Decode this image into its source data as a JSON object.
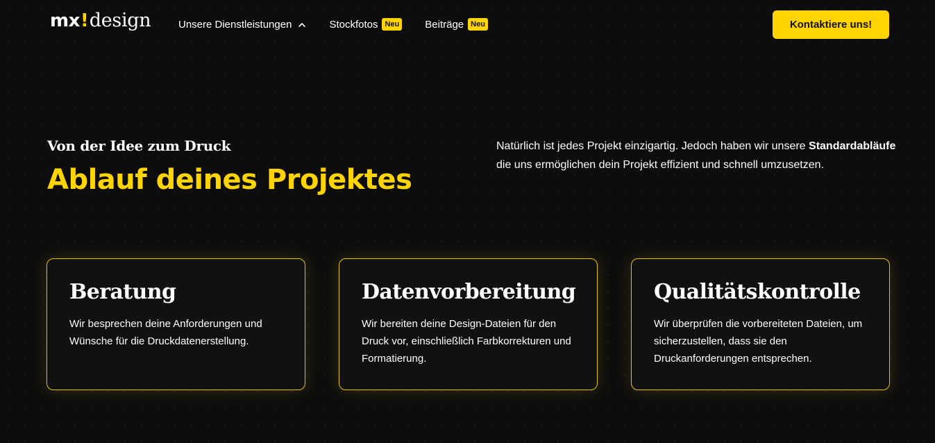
{
  "header": {
    "logo": {
      "mx": "mx",
      "bang": "!",
      "design": "design"
    },
    "nav": [
      {
        "label": "Unsere Dienstleistungen",
        "icon": "chevron-up-icon"
      },
      {
        "label": "Stockfotos",
        "badge": "Neu"
      },
      {
        "label": "Beiträge",
        "badge": "Neu"
      }
    ],
    "cta_label": "Kontaktiere uns!"
  },
  "intro": {
    "eyebrow": "Von der Idee zum Druck",
    "headline": "Ablauf deines Projektes",
    "text_start": "Natürlich ist jedes Projekt einzigartig. Jedoch haben wir unsere ",
    "text_bold": "Standardabläufe",
    "text_end": " die uns ermöglichen dein Projekt effizient und schnell umzusetzen."
  },
  "cards": [
    {
      "title": "Beratung",
      "text": "Wir besprechen deine Anforderungen und Wünsche für die Druckdatenerstellung."
    },
    {
      "title": "Datenvorbereitung",
      "text": "Wir bereiten deine Design-Dateien für den Druck vor, einschließlich Farbkorrekturen und Formatierung."
    },
    {
      "title": "Qualitätskontrolle",
      "text": "Wir überprüfen die vorbereiteten Dateien, um sicherzustellen, dass sie den Druckanforderungen entsprechen."
    }
  ],
  "colors": {
    "accent": "#ffd400",
    "background": "#0d0d0d",
    "card_border": "#e6c200"
  }
}
